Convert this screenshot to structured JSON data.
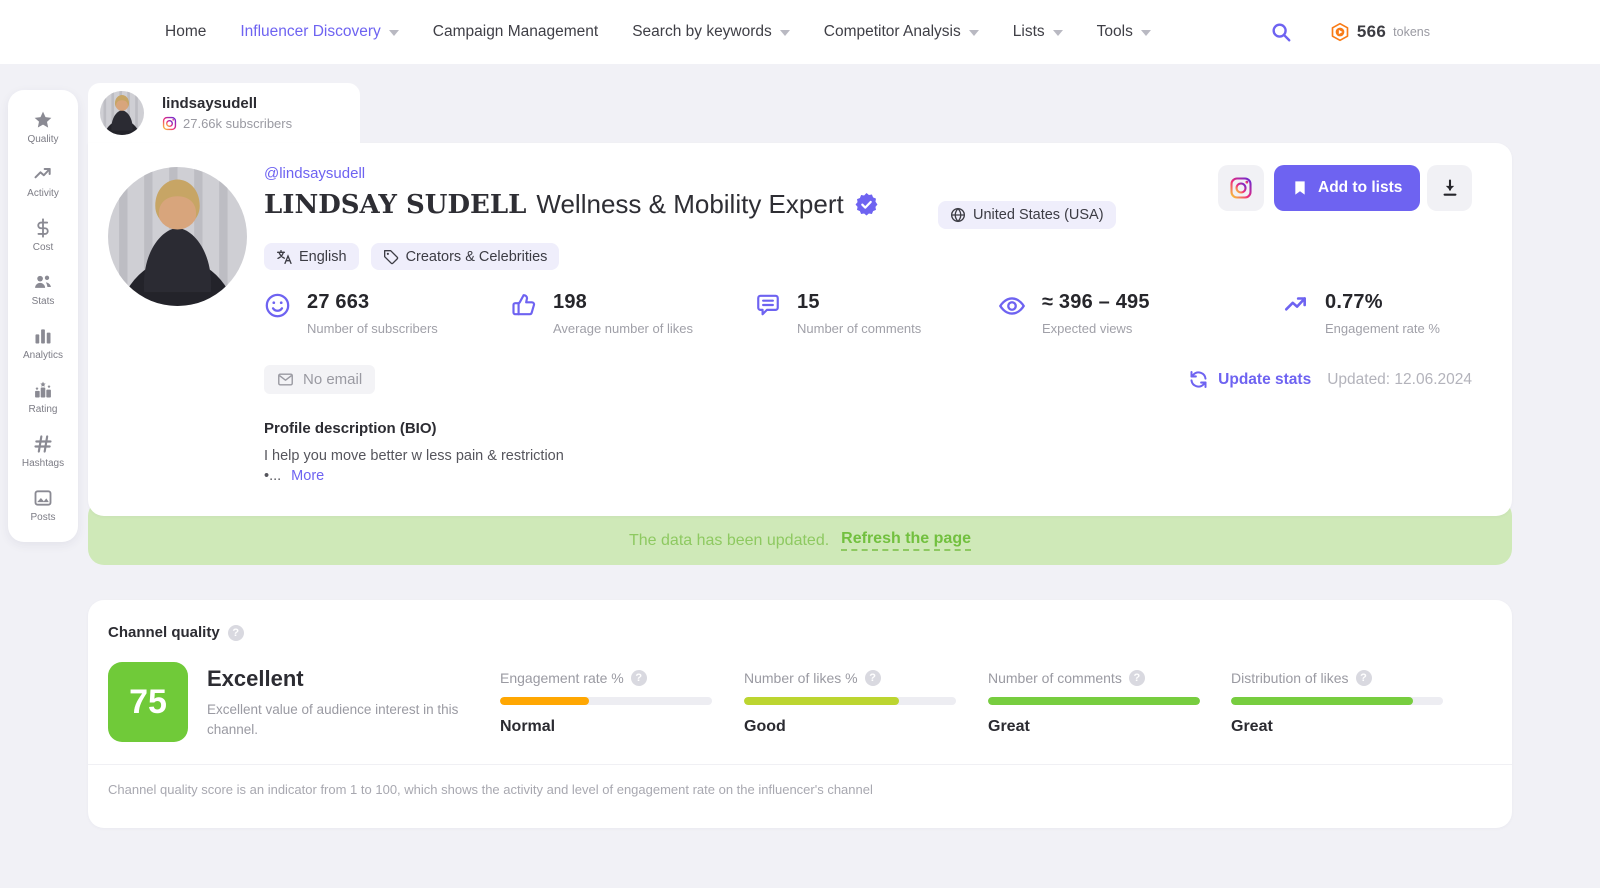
{
  "nav": {
    "items": [
      {
        "label": "Home",
        "active": false,
        "caret": false
      },
      {
        "label": "Influencer Discovery",
        "active": true,
        "caret": true
      },
      {
        "label": "Campaign Management",
        "active": false,
        "caret": false
      },
      {
        "label": "Search by keywords",
        "active": false,
        "caret": true
      },
      {
        "label": "Competitor Analysis",
        "active": false,
        "caret": true
      },
      {
        "label": "Lists",
        "active": false,
        "caret": true
      },
      {
        "label": "Tools",
        "active": false,
        "caret": true
      }
    ],
    "tokens": {
      "count": "566",
      "unit": "tokens"
    }
  },
  "sidebar": {
    "items": [
      {
        "icon": "star-icon",
        "label": "Quality"
      },
      {
        "icon": "trending-up-icon",
        "label": "Activity"
      },
      {
        "icon": "dollar-icon",
        "label": "Cost"
      },
      {
        "icon": "people-icon",
        "label": "Stats"
      },
      {
        "icon": "bar-chart-icon",
        "label": "Analytics"
      },
      {
        "icon": "podium-icon",
        "label": "Rating"
      },
      {
        "icon": "hashtag-icon",
        "label": "Hashtags"
      },
      {
        "icon": "image-icon",
        "label": "Posts"
      }
    ]
  },
  "tab": {
    "username": "lindsaysudell",
    "subscribers": "27.66k subscribers"
  },
  "profile": {
    "handle": "@lindsaysudell",
    "name_styled": "LINDSAY SUDELL",
    "name_rest": "Wellness & Mobility Expert",
    "country": "United States (USA)",
    "tags": [
      {
        "icon": "language-icon",
        "label": "English"
      },
      {
        "icon": "tag-icon",
        "label": "Creators & Celebrities"
      }
    ],
    "add_to_lists_label": "Add to lists",
    "stats": [
      {
        "icon": "smiley-icon",
        "value": "27 663",
        "label": "Number of subscribers"
      },
      {
        "icon": "thumb-up-icon",
        "value": "198",
        "label": "Average number of likes"
      },
      {
        "icon": "comment-icon",
        "value": "15",
        "label": "Number of comments"
      },
      {
        "icon": "eye-icon",
        "value": "≈ 396 – 495",
        "label": "Expected views"
      },
      {
        "icon": "trending-up-icon",
        "value": "0.77%",
        "label": "Engagement rate %"
      }
    ],
    "email_chip": "No email",
    "update_stats_label": "Update stats",
    "updated_label": "Updated: 12.06.2024",
    "bio_title": "Profile description (BIO)",
    "bio_line1": "I help you move better w less pain & restriction",
    "bio_bullet": "•...",
    "bio_more": "More"
  },
  "banner": {
    "message": "The data has been updated.",
    "link": "Refresh the page"
  },
  "quality": {
    "title": "Channel quality",
    "score": "75",
    "rating": "Excellent",
    "description": "Excellent value of audience interest in this channel.",
    "metrics": [
      {
        "label": "Engagement rate %",
        "value": "Normal",
        "percent": 42,
        "color": "#ffa702"
      },
      {
        "label": "Number of likes %",
        "value": "Good",
        "percent": 73,
        "color": "#bcd530"
      },
      {
        "label": "Number of comments",
        "value": "Great",
        "percent": 100,
        "color": "#77cd3f"
      },
      {
        "label": "Distribution of likes",
        "value": "Great",
        "percent": 86,
        "color": "#77cd3f"
      }
    ],
    "footnote": "Channel quality score is an indicator from 1 to 100, which shows the activity and level of engagement rate on the influencer's channel"
  },
  "colors": {
    "accent": "#6e63f1",
    "score_green": "#70ca39",
    "banner_bg": "#cfe9b8",
    "banner_text": "#8ec961",
    "token_orange": "#f97b16"
  }
}
